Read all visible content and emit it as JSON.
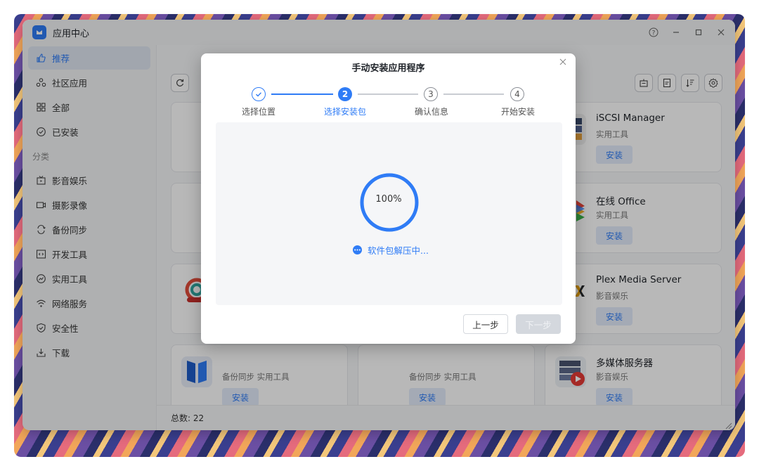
{
  "window": {
    "title": "应用中心"
  },
  "window_controls": [
    "help-icon",
    "minimize-icon",
    "maximize-icon",
    "close-icon"
  ],
  "sidebar": {
    "items": [
      {
        "label": "推荐",
        "icon": "thumbs-up-icon",
        "active": true
      },
      {
        "label": "社区应用",
        "icon": "community-icon",
        "active": false
      },
      {
        "label": "全部",
        "icon": "grid-icon",
        "active": false
      },
      {
        "label": "已安装",
        "icon": "check-circle-icon",
        "active": false
      }
    ],
    "section_label": "分类",
    "categories": [
      {
        "label": "影音娱乐",
        "icon": "tv-icon"
      },
      {
        "label": "摄影录像",
        "icon": "camera-icon"
      },
      {
        "label": "备份同步",
        "icon": "sync-icon"
      },
      {
        "label": "开发工具",
        "icon": "code-icon"
      },
      {
        "label": "实用工具",
        "icon": "chart-icon"
      },
      {
        "label": "网络服务",
        "icon": "wifi-icon"
      },
      {
        "label": "安全性",
        "icon": "shield-icon"
      },
      {
        "label": "下载",
        "icon": "download-icon"
      }
    ]
  },
  "cards": [
    {
      "name": "iSCSI Manager",
      "category": "实用工具",
      "button": "安装"
    },
    {
      "name": "在线 Office",
      "category": "实用工具",
      "button": "安装"
    },
    {
      "name": "Plex Media Server",
      "category": "影音娱乐",
      "button": "安装"
    },
    {
      "name": "多媒体服务器",
      "category": "影音娱乐",
      "button": "安装"
    },
    {
      "name": "",
      "category": "备份同步  实用工具",
      "button": "安装"
    },
    {
      "name": "",
      "category": "备份同步  实用工具",
      "button": "安装"
    }
  ],
  "footer": {
    "total": "总数: 22"
  },
  "dialog": {
    "title": "手动安装应用程序",
    "steps": [
      {
        "number": "1",
        "label": "选择位置",
        "state": "done"
      },
      {
        "number": "2",
        "label": "选择安装包",
        "state": "active"
      },
      {
        "number": "3",
        "label": "确认信息",
        "state": "todo"
      },
      {
        "number": "4",
        "label": "开始安装",
        "state": "todo"
      }
    ],
    "progress_percent": 100,
    "progress_label": "100%",
    "status_text": "软件包解压中...",
    "prev_button": "上一步",
    "next_button": "下一步"
  },
  "colors": {
    "accent": "#2f7cf6",
    "card_button_bg": "#e3ecfb",
    "disabled_button": "#d4d8de"
  }
}
